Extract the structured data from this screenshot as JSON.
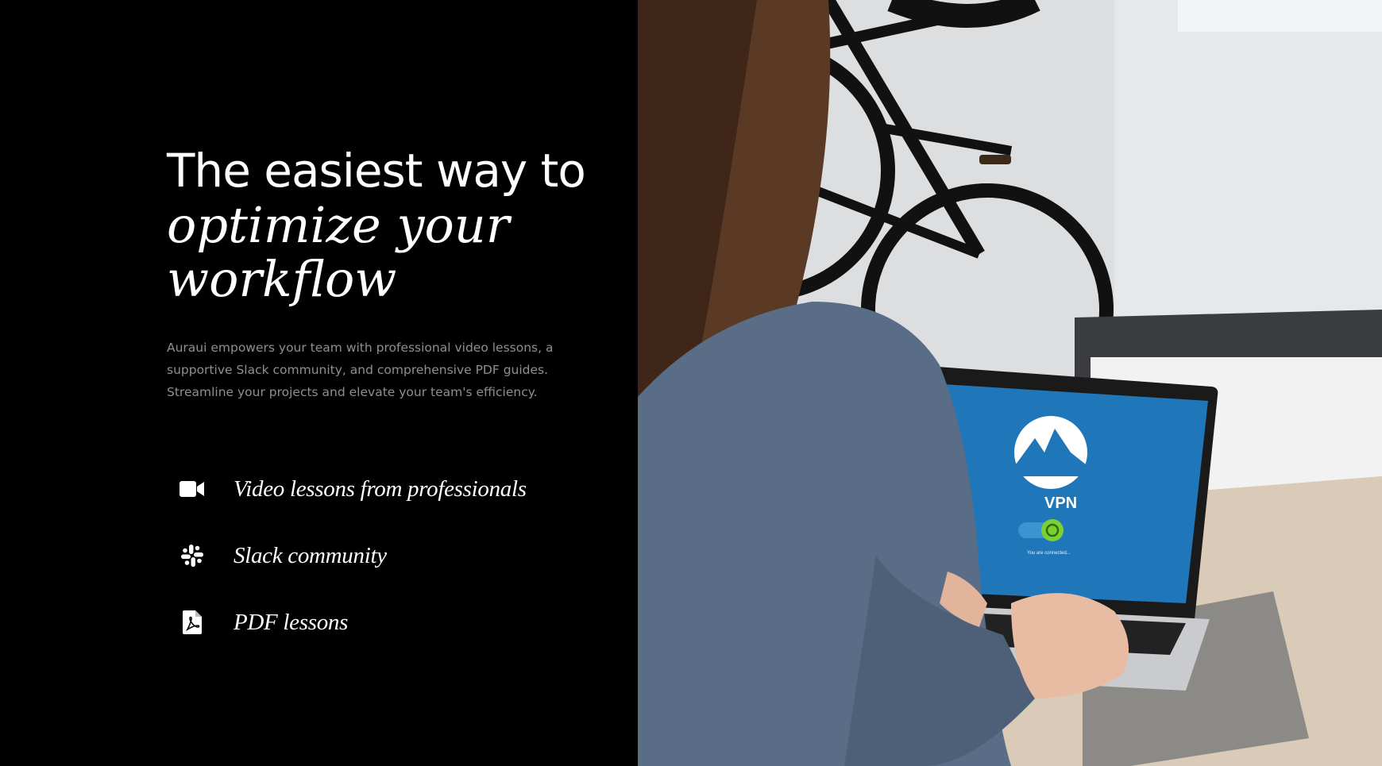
{
  "hero": {
    "title_line1": "The easiest way to",
    "title_line2": "optimize your",
    "title_line3": "workflow",
    "description": "Auraui empowers your team with professional video lessons, a supportive Slack community, and comprehensive PDF guides. Streamline your projects and elevate your team's efficiency."
  },
  "features": [
    {
      "icon": "video-camera-icon",
      "label": "Video lessons from professionals"
    },
    {
      "icon": "slack-icon",
      "label": "Slack community"
    },
    {
      "icon": "pdf-file-icon",
      "label": "PDF lessons"
    }
  ],
  "photo": {
    "screen_text": "VPN",
    "status_text": "You are connected..."
  },
  "colors": {
    "background": "#000000",
    "text": "#ffffff",
    "muted_text": "#8f8f8f",
    "screen_blue": "#1f76b8",
    "toggle_green": "#7bd032"
  }
}
